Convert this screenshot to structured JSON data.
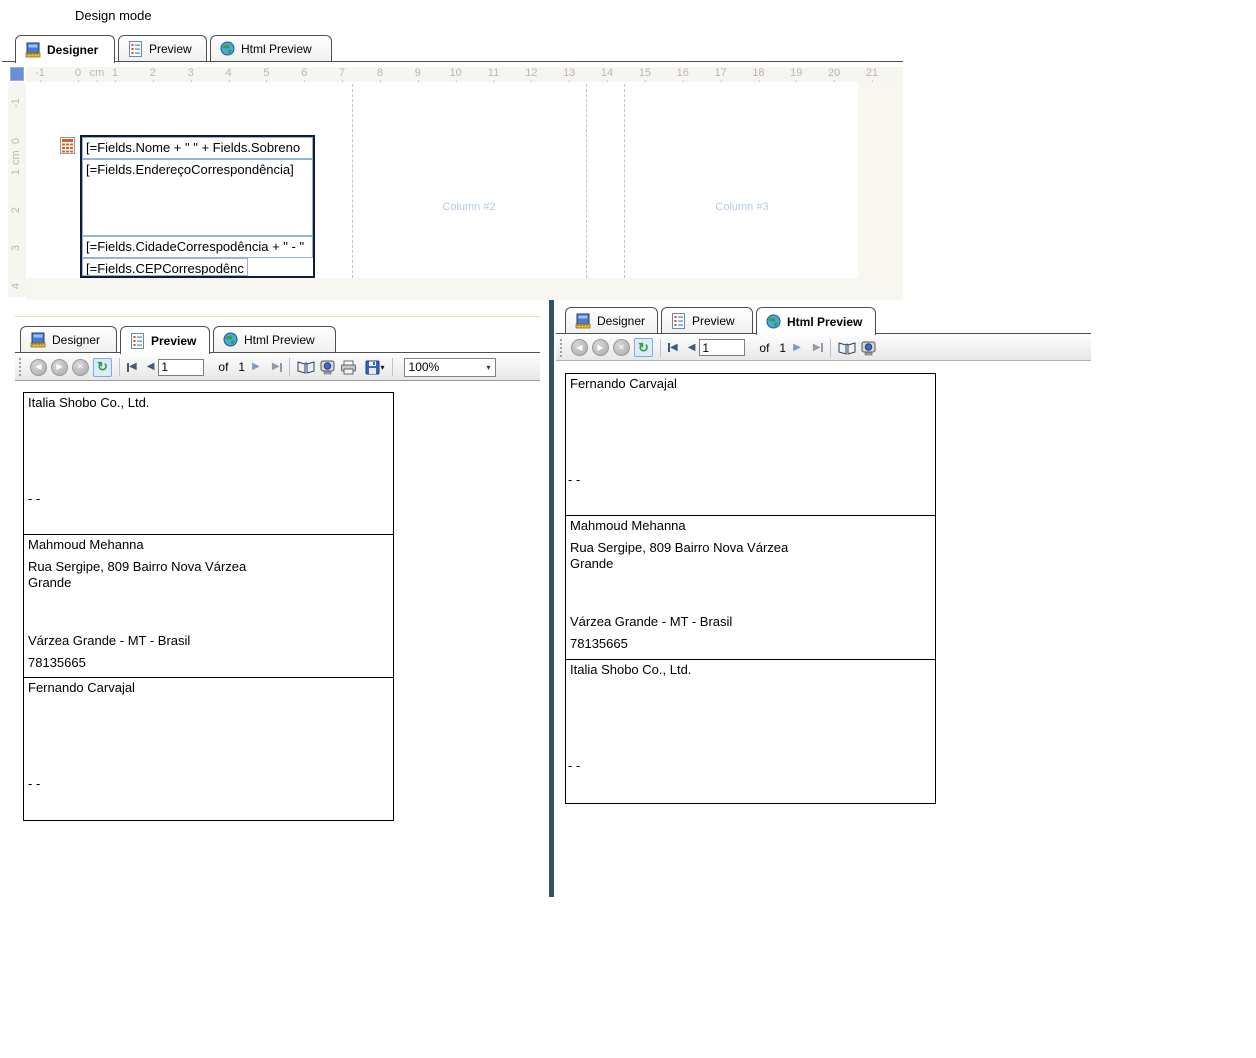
{
  "design_mode_label": "Design mode",
  "tabs": {
    "designer": "Designer",
    "preview": "Preview",
    "html_preview": "Html Preview"
  },
  "designer_panel": {
    "ruler_h": [
      "-1",
      "0",
      "cm",
      "1",
      "2",
      "3",
      "4",
      "5",
      "6",
      "7",
      "8",
      "9",
      "10",
      "11",
      "12",
      "13",
      "14",
      "15",
      "16",
      "17",
      "18",
      "19",
      "20",
      "21"
    ],
    "ruler_v": [
      "-1",
      "0",
      "cm",
      "1",
      "2",
      "3",
      "4"
    ],
    "fields": {
      "name_expr": "[=Fields.Nome + \" \" + Fields.Sobreno",
      "address_expr": "[=Fields.EndereçoCorrespondência]",
      "city_expr": "[=Fields.CidadeCorrespodência + \" - \"",
      "cep_expr": "[=Fields.CEPCorrespodênc"
    },
    "column2_label": "Column #2",
    "column3_label": "Column #3"
  },
  "preview_panel": {
    "toolbar": {
      "page_value": "1",
      "of_label": "of",
      "page_count": "1",
      "zoom_value": "100%"
    },
    "labels": [
      {
        "line1": "Italia Shobo Co., Ltd.",
        "line3": "- -"
      },
      {
        "line1": "Mahmoud Mehanna",
        "line2": "Rua Sergipe, 809 Bairro Nova Várzea Grande",
        "line3": "Várzea Grande - MT - Brasil",
        "line4": "78135665"
      },
      {
        "line1": "Fernando Carvajal",
        "line3": "- -"
      }
    ]
  },
  "html_panel": {
    "toolbar": {
      "page_value": "1",
      "of_label": "of",
      "page_count": "1"
    },
    "labels": [
      {
        "line1": "Fernando Carvajal",
        "line3": "- -"
      },
      {
        "line1": "Mahmoud Mehanna",
        "line2": "Rua Sergipe, 809 Bairro Nova Várzea Grande",
        "line3": "Várzea Grande - MT - Brasil",
        "line4": "78135665"
      },
      {
        "line1": "Italia Shobo Co., Ltd.",
        "line3": "- -"
      }
    ]
  },
  "colors": {
    "splitter": "#35516E",
    "accent_line": "#EEDFA4",
    "ruler_corner": "#6B8FD4",
    "column_label": "#B6C8E8",
    "textbox_border": "#95B3D7",
    "refresh_green": "#2E9E3E"
  }
}
